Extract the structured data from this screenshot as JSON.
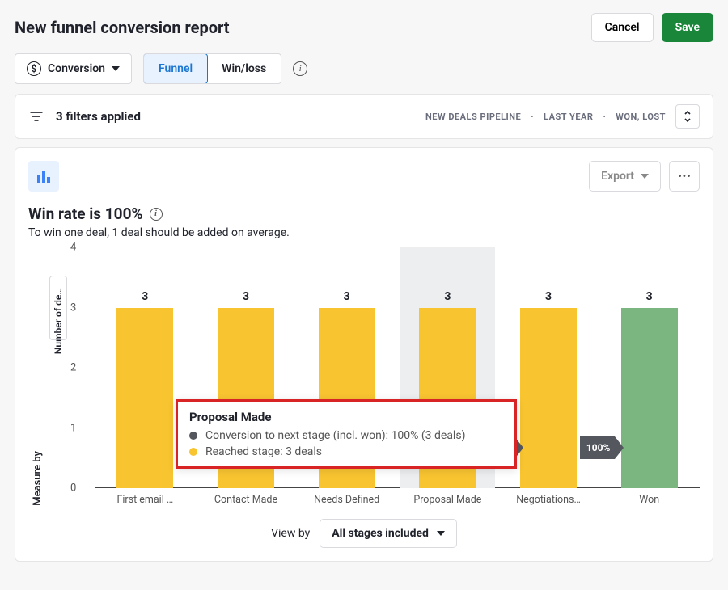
{
  "header": {
    "title": "New funnel conversion report",
    "cancel": "Cancel",
    "save": "Save"
  },
  "controls": {
    "metric_icon": "$",
    "metric_label": "Conversion",
    "tabs": [
      "Funnel",
      "Win/loss"
    ],
    "active_tab": 0
  },
  "filters": {
    "applied_label": "3 filters applied",
    "chips": [
      "NEW DEALS PIPELINE",
      "LAST YEAR",
      "WON, LOST"
    ]
  },
  "card": {
    "export": "Export",
    "winrate": "Win rate is 100%",
    "subtitle": "To win one deal, 1 deal should be added on average."
  },
  "sidecol": {
    "measure_by": "Measure by",
    "yaxis_short": "Number of de…"
  },
  "viewby": {
    "label": "View by",
    "value": "All stages included"
  },
  "tooltip": {
    "title": "Proposal Made",
    "line1": "Conversion to next stage (incl. won): 100% (3 deals)",
    "line2": "Reached stage: 3 deals",
    "dot1_color": "#55575f",
    "dot2_color": "#f8c430"
  },
  "chart_data": {
    "type": "bar",
    "title": "Win rate is 100%",
    "ylabel": "Number of deals",
    "xlabel": "",
    "ylim": [
      0,
      4
    ],
    "yticks": [
      0,
      1,
      2,
      3,
      4
    ],
    "categories": [
      "First email …",
      "Contact Made",
      "Needs Defined",
      "Proposal Made",
      "Negotiations…",
      "Won"
    ],
    "values": [
      3,
      3,
      3,
      3,
      3,
      3
    ],
    "won_index": 5,
    "highlighted_index": 3,
    "conversion_labels": {
      "3": "100%",
      "4": "100%"
    },
    "colors": {
      "bar": "#f8c430",
      "won": "#7bb681",
      "arrow": "#55575f"
    }
  }
}
